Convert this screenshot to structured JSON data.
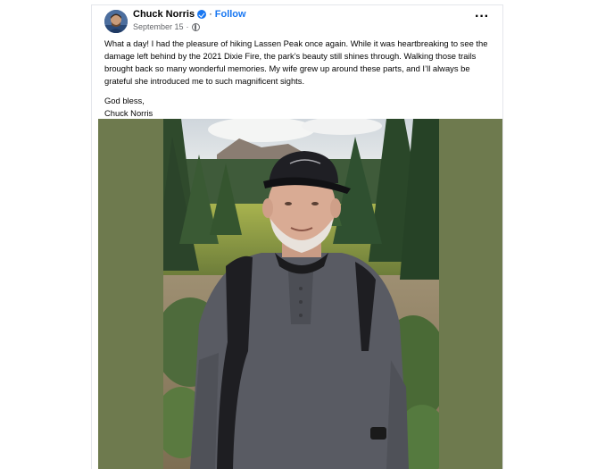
{
  "post": {
    "author": "Chuck Norris",
    "separator": "·",
    "follow_label": "Follow",
    "date": "September 15",
    "date_separator": "·",
    "more_label": "···",
    "paragraph_1": "What a day! I had the pleasure of hiking Lassen Peak once again. While it was heartbreaking to see the damage left behind by the 2021 Dixie Fire, the park’s beauty still shines through. Walking those trails brought back so many wonderful memories. My wife grew up around these parts, and I’ll always be grateful she introduced me to such magnificent sights.",
    "closing_line_1": "God bless,",
    "closing_line_2": "Chuck Norris"
  },
  "icons": {
    "verified": "verified-badge-icon",
    "privacy": "globe-icon",
    "menu": "more-options-icon"
  },
  "colors": {
    "accent": "#1877f2",
    "text": "#050505",
    "secondary_text": "#65676b",
    "photo_matte": "#6e7a4e"
  }
}
